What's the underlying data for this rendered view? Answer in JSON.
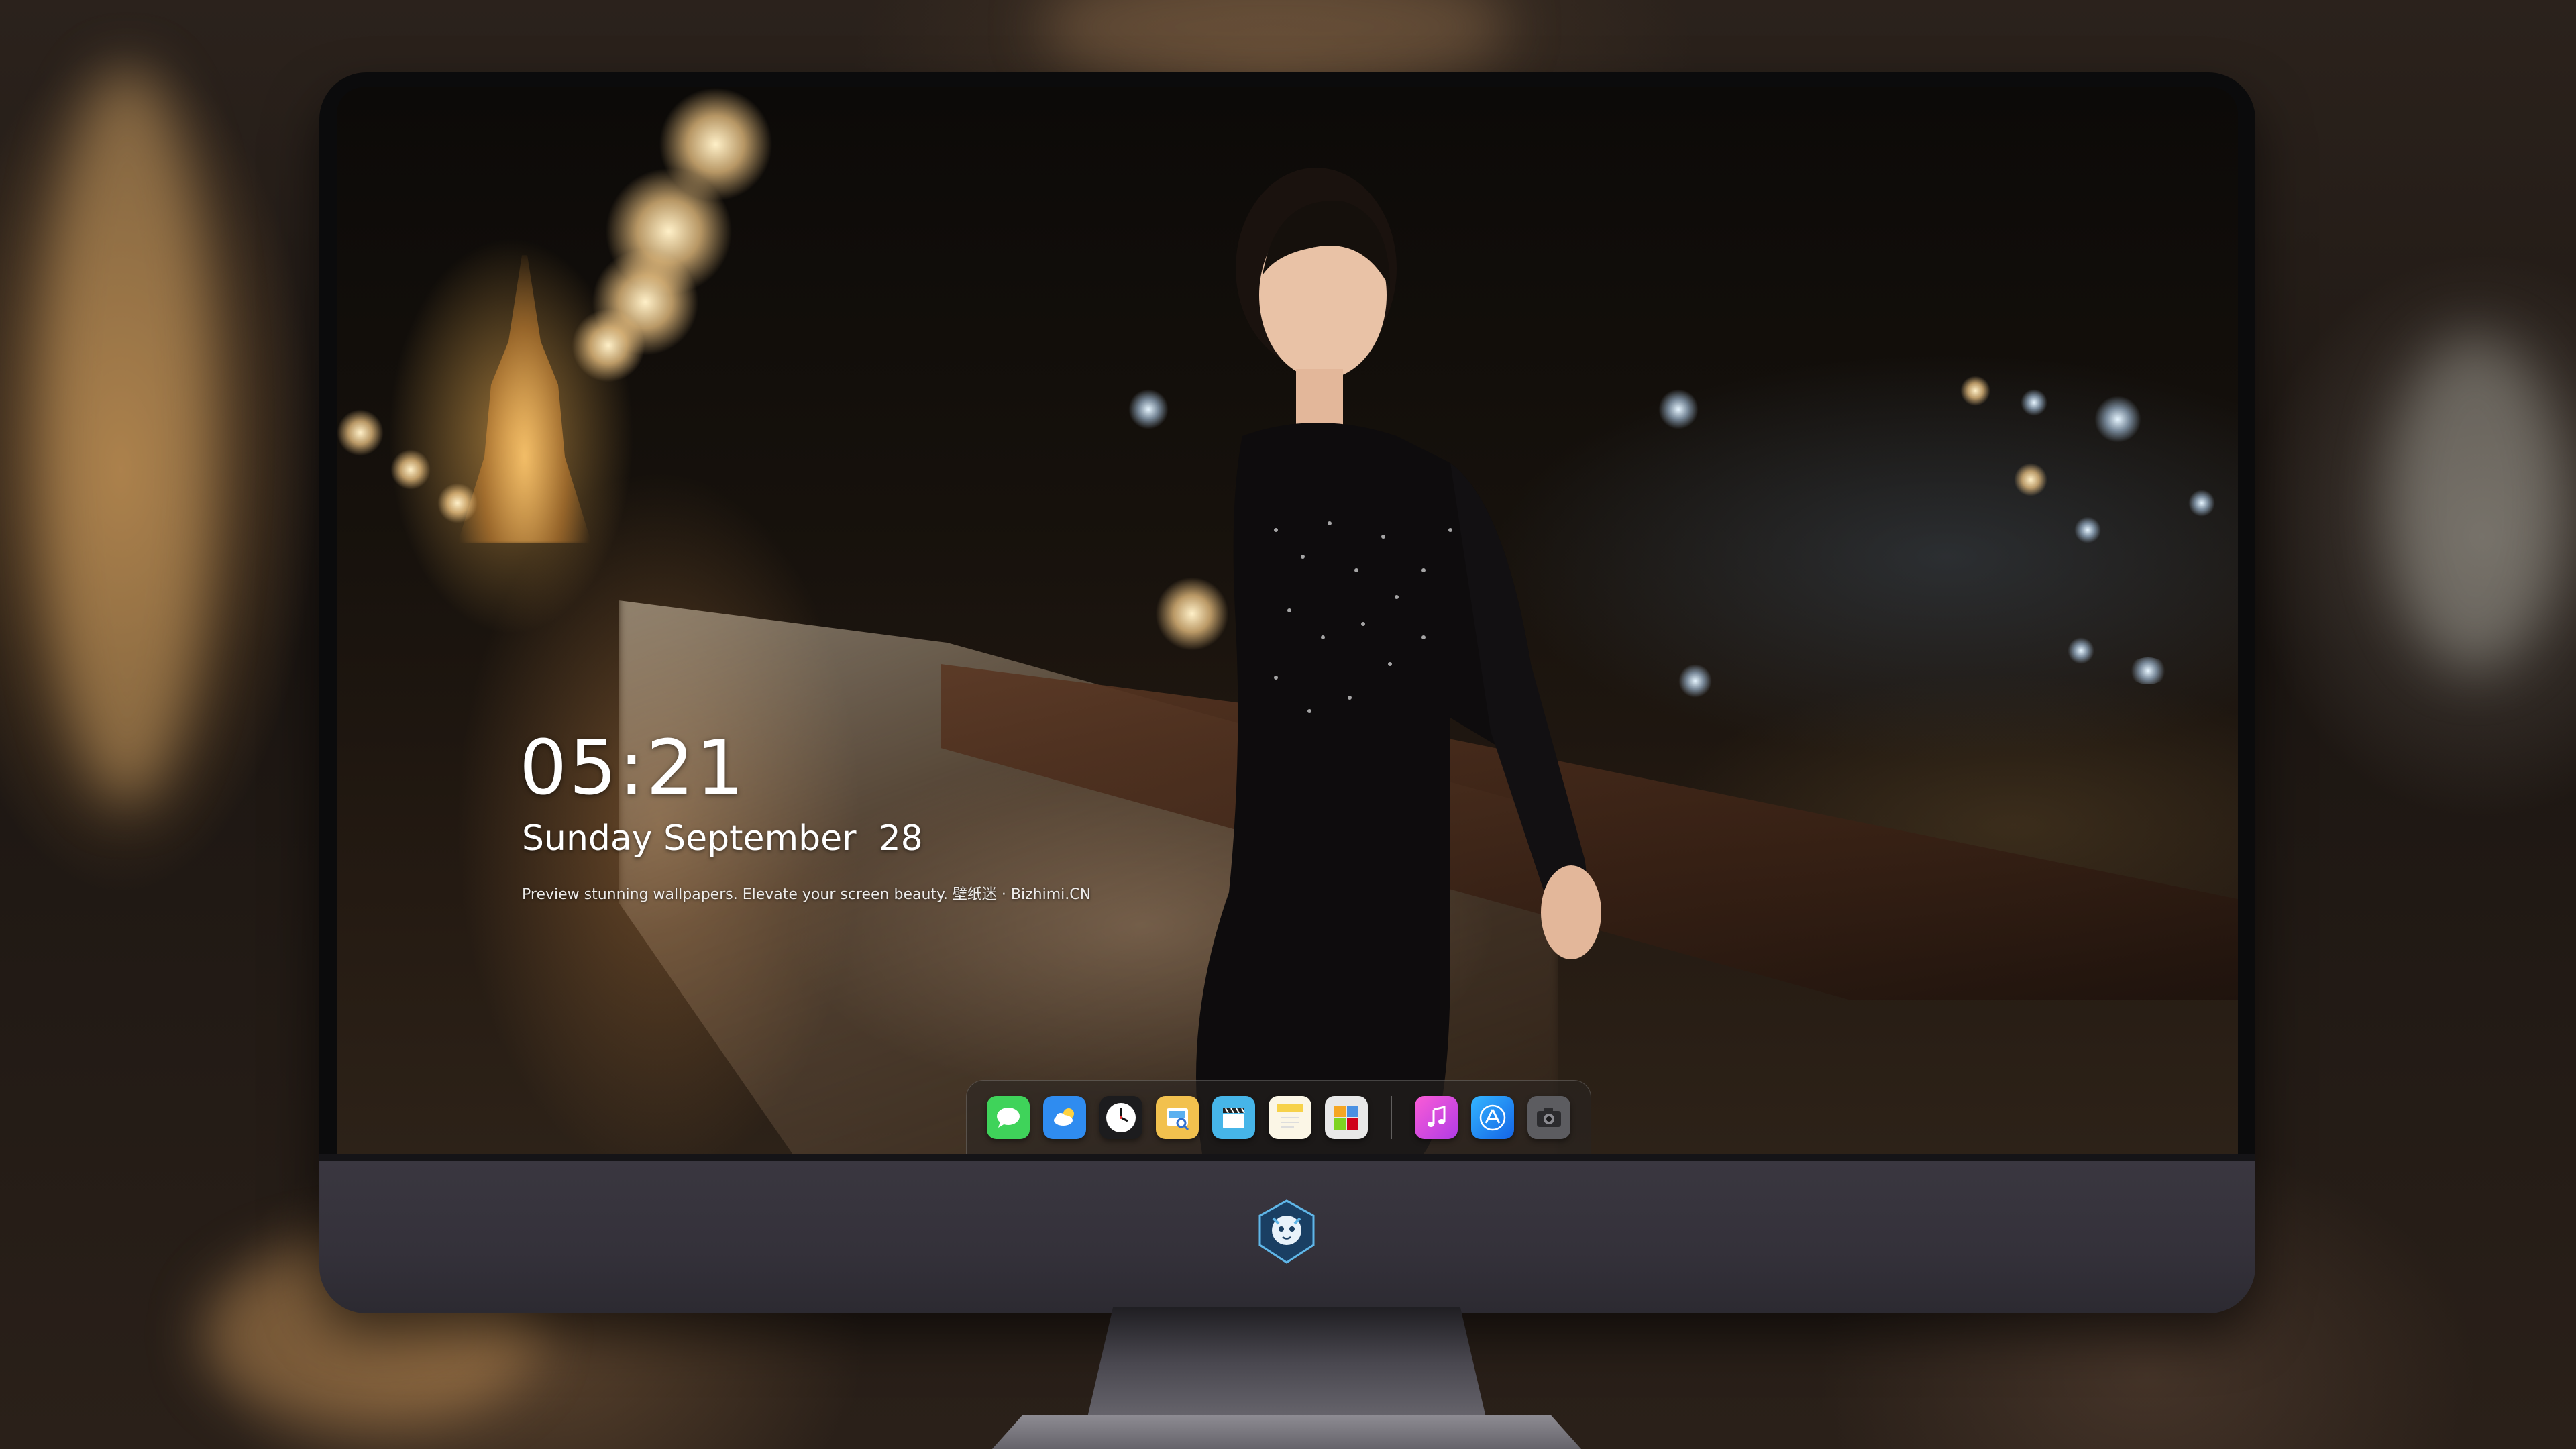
{
  "lockscreen": {
    "time": "05:21",
    "date": "Sunday September  28",
    "tagline": "Preview stunning wallpapers. Elevate your screen beauty. 壁纸迷 · Bizhimi.CN"
  },
  "dock": {
    "apps": [
      {
        "name": "messages",
        "icon": "messages-icon",
        "color": "#3fd35a"
      },
      {
        "name": "weather",
        "icon": "weather-icon",
        "color": "#2f8cf0"
      },
      {
        "name": "clock",
        "icon": "clock-icon",
        "color": "#1c1c1e"
      },
      {
        "name": "preview",
        "icon": "preview-icon",
        "color": "#f2c14e"
      },
      {
        "name": "clips",
        "icon": "clapperboard-icon",
        "color": "#46b5e8"
      },
      {
        "name": "notes",
        "icon": "notes-icon",
        "color": "#f7d24a"
      },
      {
        "name": "photo-booth",
        "icon": "photos-icon",
        "color": "#e8e8e8"
      },
      {
        "name": "music",
        "icon": "music-icon",
        "color": "#e24fd5"
      },
      {
        "name": "app-store",
        "icon": "app-store-icon",
        "color": "#1f8af0"
      },
      {
        "name": "camera",
        "icon": "camera-icon",
        "color": "#5c5c60"
      }
    ]
  },
  "monitor": {
    "logo_icon": "dragon-mascot-logo"
  }
}
